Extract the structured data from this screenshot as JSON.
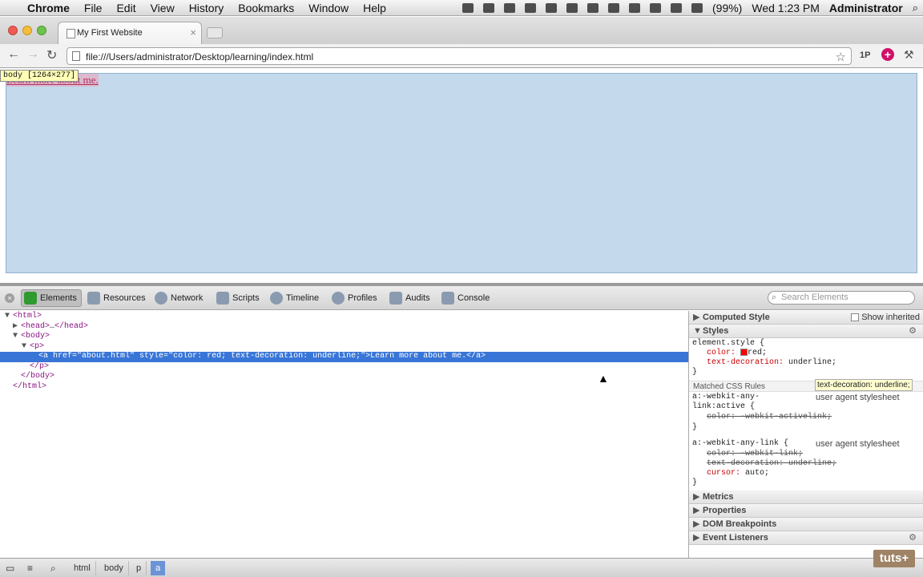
{
  "menubar": {
    "apple": "",
    "app": "Chrome",
    "items": [
      "File",
      "Edit",
      "View",
      "History",
      "Bookmarks",
      "Window",
      "Help"
    ],
    "battery": "(99%)",
    "clock": "Wed 1:23 PM",
    "user": "Administrator"
  },
  "tab": {
    "title": "My First Website",
    "close": "×"
  },
  "toolbar": {
    "url": "file:///Users/administrator/Desktop/learning/index.html",
    "onep": "1P",
    "star": "☆"
  },
  "page": {
    "link_text": "Learn more about me.",
    "badge": "body [1264×277]"
  },
  "devtools": {
    "tabs": [
      "Elements",
      "Resources",
      "Network",
      "Scripts",
      "Timeline",
      "Profiles",
      "Audits",
      "Console"
    ],
    "search_placeholder": "Search Elements",
    "dom": {
      "r1": "<html>",
      "r2a": "<head>",
      "r2b": "…",
      "r2c": "</head>",
      "r3": "<body>",
      "r4": "<p>",
      "r5_open": "<a",
      "r5_a1n": " href=",
      "r5_a1v": "\"about.html\"",
      "r5_a2n": " style=",
      "r5_a2v": "\"color: red; text-decoration: underline;\"",
      "r5_gt": ">",
      "r5_text": "Learn more about me.",
      "r5_close": "</a>",
      "r6": "</p>",
      "r7": "</body>",
      "r8": "</html>"
    },
    "sidebar": {
      "computed": "Computed Style",
      "show_inherited": "Show inherited",
      "styles": "Styles",
      "el_style": "element.style {",
      "el_color_n": "color:",
      "el_color_v": "red;",
      "el_td_n": "text-decoration:",
      "el_td_v": "underline;",
      "close_brace": "}",
      "matched": "Matched CSS Rules",
      "r1_sel1": "a:-webkit-any-",
      "r1_sel2": "link:active {",
      "r1_src": "user agent stylesheet",
      "r1_p1": "color: -webkit-activelink;",
      "r2_sel": "a:-webkit-any-link {",
      "r2_src": "user agent stylesheet",
      "r2_p1": "color: -webkit-link;",
      "r2_p2": "text-decoration: underline;",
      "r2_p3n": "cursor:",
      "r2_p3v": "auto;",
      "metrics": "Metrics",
      "properties": "Properties",
      "dom_bp": "DOM Breakpoints",
      "event_listeners": "Event Listeners",
      "tooltip": "text-decoration: underline;"
    },
    "breadcrumbs": [
      "html",
      "body",
      "p",
      "a"
    ]
  },
  "watermark": "tuts+"
}
